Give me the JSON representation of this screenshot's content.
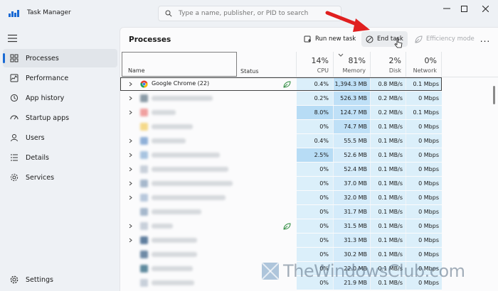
{
  "window": {
    "title": "Task Manager"
  },
  "search": {
    "placeholder": "Type a name, publisher, or PID to search"
  },
  "sidebar": {
    "items": [
      {
        "label": "Processes",
        "icon": "processes-icon",
        "active": true
      },
      {
        "label": "Performance",
        "icon": "performance-icon"
      },
      {
        "label": "App history",
        "icon": "app-history-icon"
      },
      {
        "label": "Startup apps",
        "icon": "startup-apps-icon"
      },
      {
        "label": "Users",
        "icon": "users-icon"
      },
      {
        "label": "Details",
        "icon": "details-icon"
      },
      {
        "label": "Services",
        "icon": "services-icon"
      }
    ],
    "settings_label": "Settings"
  },
  "toolbar": {
    "page_title": "Processes",
    "run_new_task": "Run new task",
    "end_task": "End task",
    "efficiency_mode": "Efficiency mode",
    "more": "..."
  },
  "table": {
    "headers": {
      "name": "Name",
      "status": "Status",
      "cpu_pct": "14%",
      "cpu": "CPU",
      "memory_pct": "81%",
      "memory": "Memory",
      "disk_pct": "2%",
      "disk": "Disk",
      "network_pct": "0%",
      "network": "Network"
    },
    "rows": [
      {
        "name": "Google Chrome (22)",
        "cpu": "0.4%",
        "memory": "1,394.3 MB",
        "disk": "0.8 MB/s",
        "network": "0.1 Mbps",
        "expandable": true,
        "leaf": true,
        "selected": true
      },
      {
        "cpu": "0.2%",
        "memory": "526.3 MB",
        "disk": "0.2 MB/s",
        "network": "0 Mbps",
        "expandable": true
      },
      {
        "cpu": "8.0%",
        "memory": "124.7 MB",
        "disk": "0.2 MB/s",
        "network": "0.1 Mbps",
        "expandable": true,
        "cpu_high": true
      },
      {
        "cpu": "0%",
        "memory": "74.7 MB",
        "disk": "0.1 MB/s",
        "network": "0 Mbps"
      },
      {
        "cpu": "0.4%",
        "memory": "55.5 MB",
        "disk": "0.1 MB/s",
        "network": "0 Mbps",
        "expandable": true
      },
      {
        "cpu": "2.5%",
        "memory": "52.6 MB",
        "disk": "0.1 MB/s",
        "network": "0 Mbps",
        "expandable": true,
        "cpu_high": true
      },
      {
        "cpu": "0%",
        "memory": "52.4 MB",
        "disk": "0.1 MB/s",
        "network": "0 Mbps",
        "expandable": true
      },
      {
        "cpu": "0%",
        "memory": "37.0 MB",
        "disk": "0.1 MB/s",
        "network": "0 Mbps",
        "expandable": true
      },
      {
        "cpu": "0%",
        "memory": "32.0 MB",
        "disk": "0.1 MB/s",
        "network": "0 Mbps",
        "expandable": true
      },
      {
        "cpu": "0%",
        "memory": "31.7 MB",
        "disk": "0.1 MB/s",
        "network": "0 Mbps"
      },
      {
        "cpu": "0%",
        "memory": "31.5 MB",
        "disk": "0.1 MB/s",
        "network": "0 Mbps",
        "expandable": true,
        "leaf": true
      },
      {
        "cpu": "0%",
        "memory": "31.3 MB",
        "disk": "0.1 MB/s",
        "network": "0 Mbps",
        "expandable": true
      },
      {
        "cpu": "0%",
        "memory": "30.2 MB",
        "disk": "0.1 MB/s",
        "network": "0 Mbps"
      },
      {
        "cpu": "0%",
        "memory": "22.0 MB",
        "disk": "0.1 MB/s",
        "network": "0 Mbps"
      },
      {
        "cpu": "0%",
        "memory": "21.9 MB",
        "disk": "0.1 MB/s",
        "network": "0 Mbps"
      }
    ]
  },
  "watermark": {
    "text": "TheWindowsClub.com"
  },
  "colors": {
    "accent": "#1a6ad4",
    "cpu_cell": "#dbeffa",
    "cpu_cell_high": "#b7dcf5",
    "arrow": "#e02020"
  }
}
